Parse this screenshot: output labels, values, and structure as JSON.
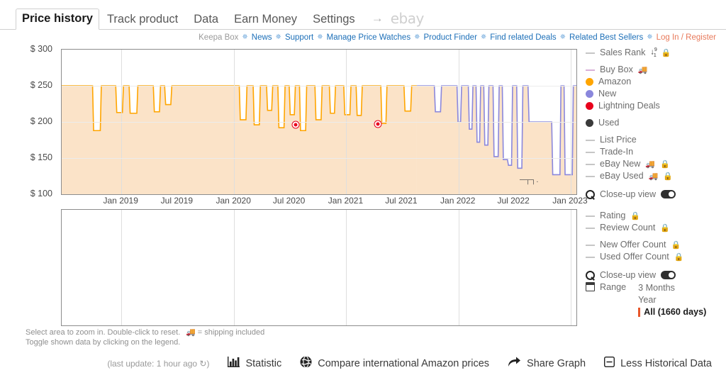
{
  "tabs": [
    {
      "label": "Price history",
      "active": true
    },
    {
      "label": "Track product",
      "active": false
    },
    {
      "label": "Data",
      "active": false
    },
    {
      "label": "Earn Money",
      "active": false
    },
    {
      "label": "Settings",
      "active": false
    }
  ],
  "tab_arrow": "→",
  "tab_ebay": "ebay",
  "linkbar": {
    "brand": "Keepa Box",
    "separator": "✵",
    "links": [
      "News",
      "Support",
      "Manage Price Watches",
      "Product Finder",
      "Find related Deals",
      "Related Best Sellers"
    ],
    "login": "Log In / Register"
  },
  "legend": {
    "groups": [
      {
        "items": [
          {
            "name": "sales-rank",
            "label": "Sales Rank",
            "marker": "dash",
            "color": "#c6c6c6",
            "sort": true,
            "lock": true,
            "truck": false
          }
        ]
      },
      {
        "items": [
          {
            "name": "buy-box",
            "label": "Buy Box",
            "marker": "dash",
            "color": "#d8b0d8",
            "sort": false,
            "lock": false,
            "truck": true
          },
          {
            "name": "amazon",
            "label": "Amazon",
            "marker": "dot",
            "color": "#FFA500",
            "sort": false,
            "lock": false,
            "truck": false
          },
          {
            "name": "new",
            "label": "New",
            "marker": "dot",
            "color": "#8A87DC",
            "sort": false,
            "lock": false,
            "truck": false
          },
          {
            "name": "lightning-deals",
            "label": "Lightning Deals",
            "marker": "dot",
            "color": "#E8001C",
            "sort": false,
            "lock": false,
            "truck": false
          }
        ]
      },
      {
        "items": [
          {
            "name": "used",
            "label": "Used",
            "marker": "dot",
            "color": "#3A3A3A",
            "sort": false,
            "lock": false,
            "truck": false
          }
        ]
      },
      {
        "items": [
          {
            "name": "list-price",
            "label": "List Price",
            "marker": "dash",
            "color": "#c6c6c6",
            "sort": false,
            "lock": false,
            "truck": false
          },
          {
            "name": "trade-in",
            "label": "Trade-In",
            "marker": "dash",
            "color": "#c6c6c6",
            "sort": false,
            "lock": false,
            "truck": false
          },
          {
            "name": "ebay-new",
            "label": "eBay New",
            "marker": "dash",
            "color": "#c6c6c6",
            "sort": false,
            "lock": true,
            "truck": true
          },
          {
            "name": "ebay-used",
            "label": "eBay Used",
            "marker": "dash",
            "color": "#c6c6c6",
            "sort": false,
            "lock": true,
            "truck": true
          }
        ]
      }
    ],
    "closeup_top": "Close-up view",
    "groups2": [
      {
        "items": [
          {
            "name": "rating",
            "label": "Rating",
            "marker": "dash",
            "color": "#c6c6c6",
            "sort": false,
            "lock": true,
            "truck": false
          },
          {
            "name": "review-count",
            "label": "Review Count",
            "marker": "dash",
            "color": "#c6c6c6",
            "sort": false,
            "lock": true,
            "truck": false
          }
        ]
      },
      {
        "items": [
          {
            "name": "new-offer-count",
            "label": "New Offer Count",
            "marker": "dash",
            "color": "#c6c6c6",
            "sort": false,
            "lock": true,
            "truck": false
          },
          {
            "name": "used-offer-count",
            "label": "Used Offer Count",
            "marker": "dash",
            "color": "#c6c6c6",
            "sort": false,
            "lock": true,
            "truck": false
          }
        ]
      }
    ],
    "closeup_bottom": "Close-up view",
    "range_label": "Range",
    "range_options": [
      {
        "label": "3 Months",
        "selected": false
      },
      {
        "label": "Year",
        "selected": false
      },
      {
        "label": "All (1660 days)",
        "selected": true
      }
    ]
  },
  "hints": {
    "line1": "Select area to zoom in. Double-click to reset.",
    "line2": "Toggle shown data by clicking on the legend.",
    "shipping_note": "= shipping included"
  },
  "footer": {
    "last_update": "(last update: 1 hour ago ↻)",
    "statistic": "Statistic",
    "compare": "Compare international Amazon prices",
    "share": "Share Graph",
    "less_data": "Less Historical Data"
  },
  "chart_data": {
    "type": "line",
    "title": "Price history",
    "xlabel": "",
    "ylabel": "",
    "ylim": [
      100,
      300
    ],
    "yticks": [
      300,
      250,
      200,
      150,
      100
    ],
    "ytick_labels": [
      "$ 300",
      "$ 250",
      "$ 200",
      "$ 150",
      "$ 100"
    ],
    "xticks": [
      "Jan 2019",
      "Jul 2019",
      "Jan 2020",
      "Jul 2020",
      "Jan 2021",
      "Jul 2021",
      "Jan 2022",
      "Jul 2022",
      "Jan 2023"
    ],
    "xlim": [
      "2018-09",
      "2023-04"
    ],
    "grid": true,
    "legend_position": "right",
    "series": [
      {
        "name": "Amazon",
        "color": "#FFA500",
        "fill": "#FBE3C8",
        "type": "step",
        "points": [
          {
            "x": 0.0,
            "y": 250
          },
          {
            "x": 0.06,
            "y": 250
          },
          {
            "x": 0.062,
            "y": 188
          },
          {
            "x": 0.075,
            "y": 188
          },
          {
            "x": 0.077,
            "y": 250
          },
          {
            "x": 0.105,
            "y": 250
          },
          {
            "x": 0.107,
            "y": 213
          },
          {
            "x": 0.118,
            "y": 213
          },
          {
            "x": 0.12,
            "y": 250
          },
          {
            "x": 0.131,
            "y": 250
          },
          {
            "x": 0.133,
            "y": 212
          },
          {
            "x": 0.146,
            "y": 212
          },
          {
            "x": 0.148,
            "y": 250
          },
          {
            "x": 0.178,
            "y": 250
          },
          {
            "x": 0.18,
            "y": 214
          },
          {
            "x": 0.19,
            "y": 214
          },
          {
            "x": 0.192,
            "y": 250
          },
          {
            "x": 0.2,
            "y": 250
          },
          {
            "x": 0.202,
            "y": 224
          },
          {
            "x": 0.212,
            "y": 224
          },
          {
            "x": 0.214,
            "y": 250
          },
          {
            "x": 0.345,
            "y": 250
          },
          {
            "x": 0.347,
            "y": 203
          },
          {
            "x": 0.358,
            "y": 203
          },
          {
            "x": 0.36,
            "y": 250
          },
          {
            "x": 0.372,
            "y": 250
          },
          {
            "x": 0.374,
            "y": 196
          },
          {
            "x": 0.384,
            "y": 196
          },
          {
            "x": 0.386,
            "y": 250
          },
          {
            "x": 0.398,
            "y": 250
          },
          {
            "x": 0.4,
            "y": 216
          },
          {
            "x": 0.408,
            "y": 216
          },
          {
            "x": 0.41,
            "y": 250
          },
          {
            "x": 0.42,
            "y": 250
          },
          {
            "x": 0.422,
            "y": 192
          },
          {
            "x": 0.432,
            "y": 192
          },
          {
            "x": 0.434,
            "y": 250
          },
          {
            "x": 0.442,
            "y": 250
          },
          {
            "x": 0.444,
            "y": 210
          },
          {
            "x": 0.452,
            "y": 210
          },
          {
            "x": 0.454,
            "y": 250
          },
          {
            "x": 0.462,
            "y": 250
          },
          {
            "x": 0.464,
            "y": 188
          },
          {
            "x": 0.474,
            "y": 188
          },
          {
            "x": 0.476,
            "y": 250
          },
          {
            "x": 0.492,
            "y": 250
          },
          {
            "x": 0.494,
            "y": 203
          },
          {
            "x": 0.504,
            "y": 203
          },
          {
            "x": 0.506,
            "y": 250
          },
          {
            "x": 0.52,
            "y": 250
          },
          {
            "x": 0.522,
            "y": 212
          },
          {
            "x": 0.53,
            "y": 212
          },
          {
            "x": 0.532,
            "y": 250
          },
          {
            "x": 0.548,
            "y": 250
          },
          {
            "x": 0.55,
            "y": 210
          },
          {
            "x": 0.56,
            "y": 210
          },
          {
            "x": 0.562,
            "y": 250
          },
          {
            "x": 0.572,
            "y": 250
          },
          {
            "x": 0.574,
            "y": 209
          },
          {
            "x": 0.582,
            "y": 209
          },
          {
            "x": 0.584,
            "y": 250
          },
          {
            "x": 0.62,
            "y": 250
          },
          {
            "x": 0.622,
            "y": 198
          },
          {
            "x": 0.63,
            "y": 198
          },
          {
            "x": 0.632,
            "y": 250
          },
          {
            "x": 0.665,
            "y": 250
          },
          {
            "x": 0.667,
            "y": 215
          },
          {
            "x": 0.678,
            "y": 215
          },
          {
            "x": 0.68,
            "y": 250
          },
          {
            "x": 0.69,
            "y": 250
          }
        ]
      },
      {
        "name": "New",
        "color": "#8A87DC",
        "type": "step",
        "points": [
          {
            "x": 0.69,
            "y": 250
          },
          {
            "x": 0.724,
            "y": 250
          },
          {
            "x": 0.726,
            "y": 214
          },
          {
            "x": 0.736,
            "y": 214
          },
          {
            "x": 0.738,
            "y": 250
          },
          {
            "x": 0.768,
            "y": 250
          },
          {
            "x": 0.77,
            "y": 200
          },
          {
            "x": 0.775,
            "y": 200
          },
          {
            "x": 0.777,
            "y": 250
          },
          {
            "x": 0.79,
            "y": 250
          },
          {
            "x": 0.792,
            "y": 190
          },
          {
            "x": 0.797,
            "y": 190
          },
          {
            "x": 0.799,
            "y": 250
          },
          {
            "x": 0.805,
            "y": 250
          },
          {
            "x": 0.807,
            "y": 172
          },
          {
            "x": 0.812,
            "y": 172
          },
          {
            "x": 0.814,
            "y": 250
          },
          {
            "x": 0.82,
            "y": 250
          },
          {
            "x": 0.822,
            "y": 168
          },
          {
            "x": 0.828,
            "y": 168
          },
          {
            "x": 0.83,
            "y": 250
          },
          {
            "x": 0.838,
            "y": 250
          },
          {
            "x": 0.84,
            "y": 152
          },
          {
            "x": 0.848,
            "y": 152
          },
          {
            "x": 0.85,
            "y": 250
          },
          {
            "x": 0.856,
            "y": 250
          },
          {
            "x": 0.858,
            "y": 148
          },
          {
            "x": 0.866,
            "y": 148
          },
          {
            "x": 0.868,
            "y": 140
          },
          {
            "x": 0.874,
            "y": 140
          },
          {
            "x": 0.876,
            "y": 250
          },
          {
            "x": 0.884,
            "y": 250
          },
          {
            "x": 0.886,
            "y": 136
          },
          {
            "x": 0.894,
            "y": 136
          },
          {
            "x": 0.896,
            "y": 250
          },
          {
            "x": 0.906,
            "y": 250
          },
          {
            "x": 0.908,
            "y": 200
          },
          {
            "x": 0.952,
            "y": 200
          },
          {
            "x": 0.954,
            "y": 127
          },
          {
            "x": 0.968,
            "y": 127
          },
          {
            "x": 0.97,
            "y": 250
          },
          {
            "x": 0.976,
            "y": 250
          },
          {
            "x": 0.978,
            "y": 127
          },
          {
            "x": 0.992,
            "y": 127
          },
          {
            "x": 0.994,
            "y": 250
          },
          {
            "x": 1.0,
            "y": 250
          }
        ]
      }
    ],
    "markers": [
      {
        "series": "Lightning Deals",
        "x": 0.455,
        "y": 196,
        "color": "#E8001C"
      },
      {
        "series": "Lightning Deals",
        "x": 0.615,
        "y": 197,
        "color": "#E8001C"
      }
    ]
  }
}
